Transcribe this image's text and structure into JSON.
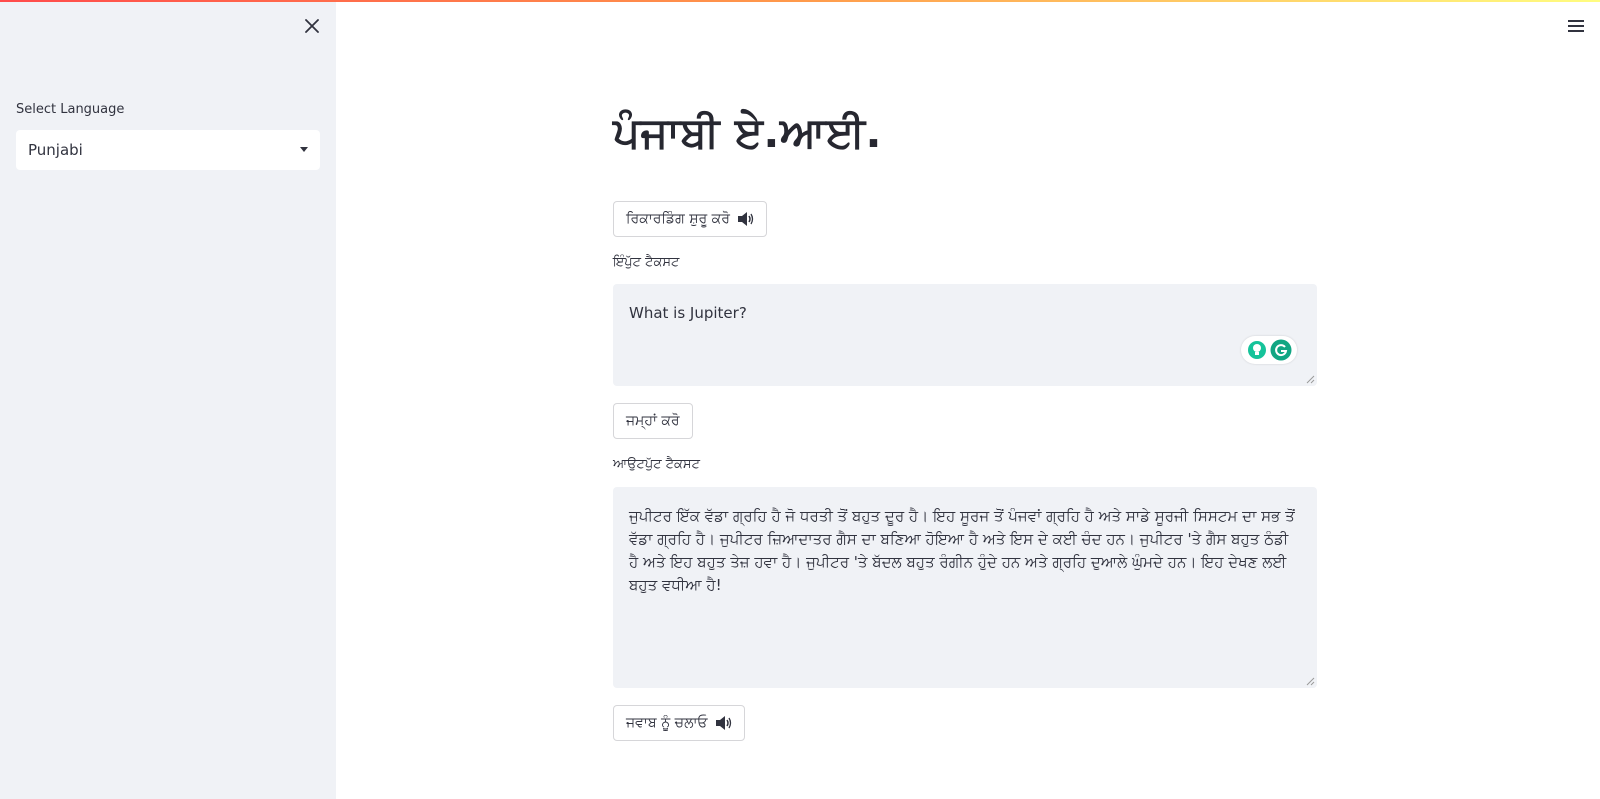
{
  "sidebar": {
    "close_icon": "close-icon",
    "label": "Select Language",
    "selected_language": "Punjabi"
  },
  "header": {
    "menu_icon": "hamburger-menu-icon"
  },
  "main": {
    "title": "ਪੰਜਾਬੀ ਏ.ਆਈ.",
    "record_button": "ਰਿਕਾਰਡਿੰਗ ਸ਼ੁਰੂ ਕਰੋ",
    "input_label": "ਇੰਪੁੱਟ ਟੈਕਸਟ",
    "input_value": "What is Jupiter?",
    "submit_button": "ਜਮ੍ਹਾਂ ਕਰੋ",
    "output_label": "ਆਉਟਪੁੱਟ ਟੈਕਸਟ",
    "output_value": "ਜੁਪੀਟਰ ਇੱਕ ਵੱਡਾ ਗ੍ਰਹਿ ਹੈ ਜੋ ਧਰਤੀ ਤੋਂ ਬਹੁਤ ਦੂਰ ਹੈ। ਇਹ ਸੂਰਜ ਤੋਂ ਪੰਜਵਾਂ ਗ੍ਰਹਿ ਹੈ ਅਤੇ ਸਾਡੇ ਸੂਰਜੀ ਸਿਸਟਮ ਦਾ ਸਭ ਤੋਂ ਵੱਡਾ ਗ੍ਰਹਿ ਹੈ। ਜੁਪੀਟਰ ਜ਼ਿਆਦਾਤਰ ਗੈਸ ਦਾ ਬਣਿਆ ਹੋਇਆ ਹੈ ਅਤੇ ਇਸ ਦੇ ਕਈ ਚੰਦ ਹਨ। ਜੁਪੀਟਰ 'ਤੇ ਗੈਸ ਬਹੁਤ ਠੰਡੀ ਹੈ ਅਤੇ ਇਹ ਬਹੁਤ ਤੇਜ਼ ਹਵਾ ਹੈ। ਜੁਪੀਟਰ 'ਤੇ ਬੱਦਲ ਬਹੁਤ ਰੰਗੀਨ ਹੁੰਦੇ ਹਨ ਅਤੇ ਗ੍ਰਹਿ ਦੁਆਲੇ ਘੁੰਮਦੇ ਹਨ। ਇਹ ਦੇਖਣ ਲਈ ਬਹੁਤ ਵਧੀਆ ਹੈ!",
    "play_button": "ਜਵਾਬ ਨੂੰ ਚਲਾਓ"
  },
  "colors": {
    "sidebar_bg": "#f0f2f6",
    "text": "#31333f",
    "grammarly_green": "#15c39a"
  }
}
